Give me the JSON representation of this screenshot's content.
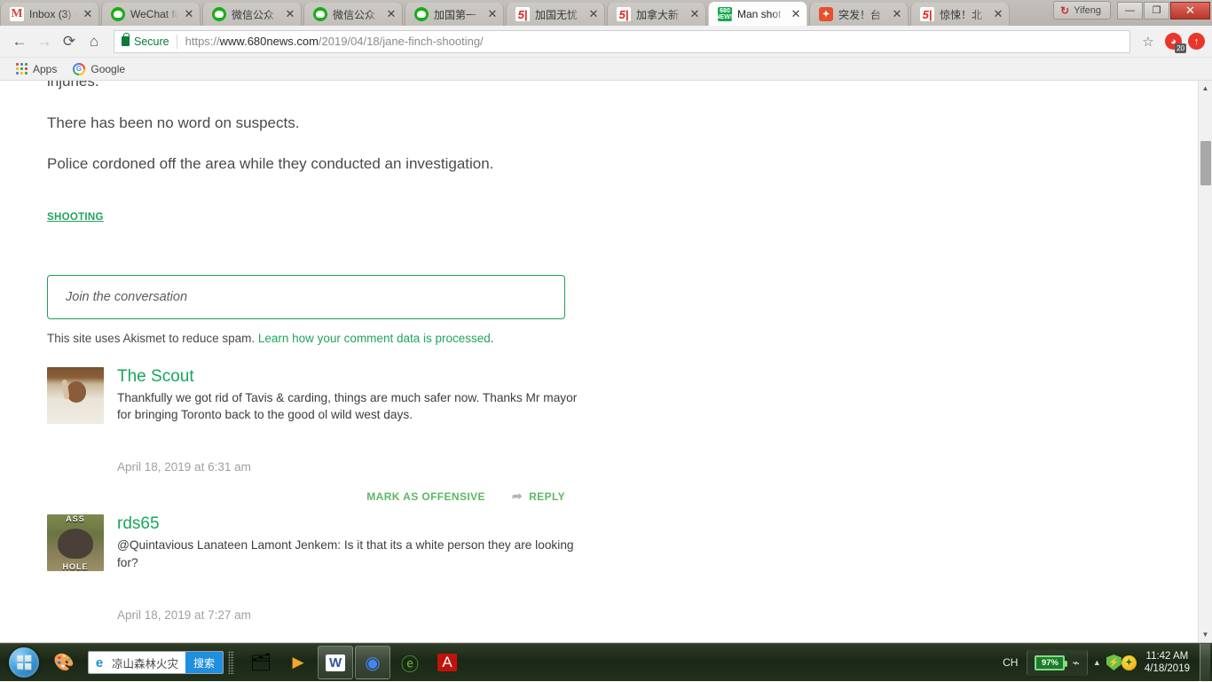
{
  "browser": {
    "tabs": [
      {
        "title": "Inbox (3) -",
        "favicon": "gmail-icon",
        "active": false
      },
      {
        "title": "WeChat fo",
        "favicon": "wechat-icon",
        "active": false
      },
      {
        "title": "微信公众",
        "favicon": "wechat-icon",
        "active": false
      },
      {
        "title": "微信公众",
        "favicon": "wechat-icon",
        "active": false
      },
      {
        "title": "加国第一",
        "favicon": "wechat-icon",
        "active": false
      },
      {
        "title": "加国无忧",
        "favicon": "51-icon",
        "active": false
      },
      {
        "title": "加拿大新",
        "favicon": "51-icon",
        "active": false
      },
      {
        "title": "Man shot",
        "favicon": "680news-icon",
        "active": true
      },
      {
        "title": "突发！台",
        "favicon": "sina-icon",
        "active": false
      },
      {
        "title": "惊悚！北",
        "favicon": "51-icon",
        "active": false
      }
    ],
    "tab_close_glyph": "✕",
    "window": {
      "user_label": "Yifeng",
      "user_glyph": "↻",
      "minimize_glyph": "—",
      "maximize_glyph": "❐",
      "close_glyph": "✕"
    },
    "toolbar": {
      "back_glyph": "←",
      "forward_glyph": "→",
      "reload_glyph": "⟳",
      "home_glyph": "⌂",
      "secure_label": "Secure",
      "url_scheme": "https://",
      "url_host": "www.680news.com",
      "url_path": "/2019/04/18/jane-finch-shooting/",
      "star_glyph": "☆",
      "extension_badge": "20",
      "extension_glyph": "◕",
      "extension2_glyph": "↑"
    },
    "bookmarks": [
      {
        "label": "Apps",
        "icon": "apps-grid-icon"
      },
      {
        "label": "Google",
        "icon": "google-g-icon"
      }
    ]
  },
  "page": {
    "paragraphs": [
      "injuries.",
      "There has been no word on suspects.",
      "Police cordoned off the area while they conducted an investigation."
    ],
    "tag": "SHOOTING",
    "comment_form": {
      "placeholder": "Join the conversation",
      "akismet_text": "This site uses Akismet to reduce spam.",
      "akismet_link": "Learn how your comment data is processed",
      "akismet_period": "."
    },
    "comments": [
      {
        "author": "The Scout",
        "avatar": "photo-avatar-man-pointing",
        "text": "Thankfully we got rid of Tavis & carding, things are much safer now. Thanks Mr mayor for bringing Toronto back to the good ol wild west days.",
        "date": "April 18, 2019 at 6:31 am",
        "actions": {
          "offensive": "MARK AS OFFENSIVE",
          "reply": "REPLY",
          "reply_icon": "➦"
        }
      },
      {
        "author": "rds65",
        "avatar": "photo-avatar-donkey",
        "avatar_top_text": "ASS",
        "avatar_bottom_text": "HOLE",
        "text": "@Quintavious Lanateen Lamont Jenkem: Is it that its a white person they are looking for?",
        "date": "April 18, 2019 at 7:27 am"
      }
    ],
    "scrollbar": {
      "up_glyph": "▲",
      "down_glyph": "▼"
    }
  },
  "taskbar": {
    "start_label": "Start",
    "ie_search": {
      "query": "凉山森林火灾",
      "button": "搜索",
      "icon_glyph": "e"
    },
    "pinned": [
      {
        "name": "sound-mixer-icon",
        "glyph": "🎨"
      },
      {
        "name": "file-explorer-icon",
        "glyph": "🗂"
      },
      {
        "name": "media-player-icon",
        "glyph": "▶"
      },
      {
        "name": "word-icon",
        "glyph": "W"
      },
      {
        "name": "chrome-icon",
        "glyph": "◉"
      },
      {
        "name": "maxthon-icon",
        "glyph": "e"
      },
      {
        "name": "acrobat-icon",
        "glyph": "A"
      }
    ],
    "tray": {
      "language": "CH",
      "battery": "97%",
      "plug_glyph": "🔌",
      "expand_glyph": "▲",
      "shield_glyph": "⚡",
      "circle_glyph": "✦",
      "time": "11:42 AM",
      "date": "4/18/2019"
    }
  },
  "colors": {
    "accent_green": "#16a75a",
    "link_green": "#22a45d",
    "secure_green": "#0b7a3b",
    "text_dark": "#3d3d3d",
    "text_muted": "#a0a0a0"
  }
}
